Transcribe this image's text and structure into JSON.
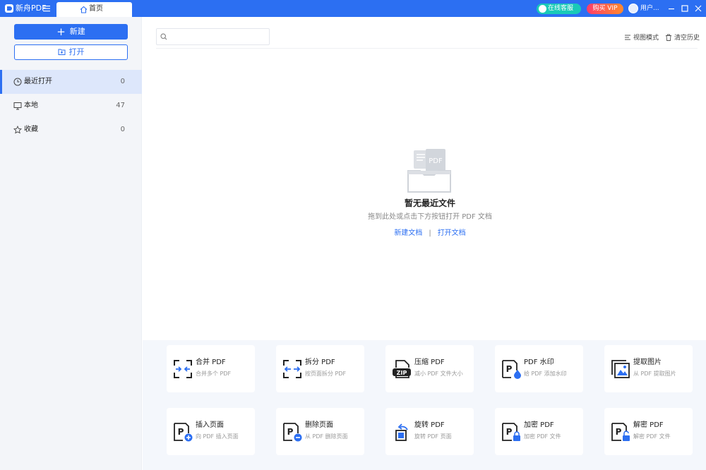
{
  "titlebar": {
    "app_name": "新舟PDF",
    "tab_label": "首页",
    "service_label": "在线客服",
    "vip_label": "购买 VIP",
    "user_name": "用户...",
    "accent": "#2c6ff2"
  },
  "sidebar": {
    "new_label": "新建",
    "open_label": "打开",
    "items": [
      {
        "label": "最近打开",
        "count": "0",
        "icon": "clock-icon"
      },
      {
        "label": "本地",
        "count": "47",
        "icon": "monitor-icon"
      },
      {
        "label": "收藏",
        "count": "0",
        "icon": "star-icon"
      }
    ]
  },
  "main": {
    "search_placeholder": "",
    "view_mode_label": "视图模式",
    "clear_history_label": "清空历史",
    "empty_title": "暂无最近文件",
    "empty_desc": "拖到此处或点击下方按钮打开 PDF 文档",
    "new_doc_link": "新建文档",
    "link_separator": "|",
    "open_doc_link": "打开文档"
  },
  "tools": [
    {
      "title": "合并 PDF",
      "sub": "合并多个 PDF",
      "icon": "merge-icon"
    },
    {
      "title": "拆分 PDF",
      "sub": "按页面拆分 PDF",
      "icon": "split-icon"
    },
    {
      "title": "压缩 PDF",
      "sub": "减小 PDF 文件大小",
      "icon": "zip-icon"
    },
    {
      "title": "PDF 水印",
      "sub": "给 PDF 添加水印",
      "icon": "watermark-icon"
    },
    {
      "title": "提取图片",
      "sub": "从 PDF 提取图片",
      "icon": "image-extract-icon"
    },
    {
      "title": "插入页面",
      "sub": "向 PDF 插入页面",
      "icon": "insert-page-icon"
    },
    {
      "title": "删除页面",
      "sub": "从 PDF 删除页面",
      "icon": "delete-page-icon"
    },
    {
      "title": "旋转 PDF",
      "sub": "旋转 PDF 页面",
      "icon": "rotate-icon"
    },
    {
      "title": "加密 PDF",
      "sub": "加密 PDF 文件",
      "icon": "lock-icon"
    },
    {
      "title": "解密 PDF",
      "sub": "解密 PDF 文件",
      "icon": "unlock-icon"
    }
  ]
}
